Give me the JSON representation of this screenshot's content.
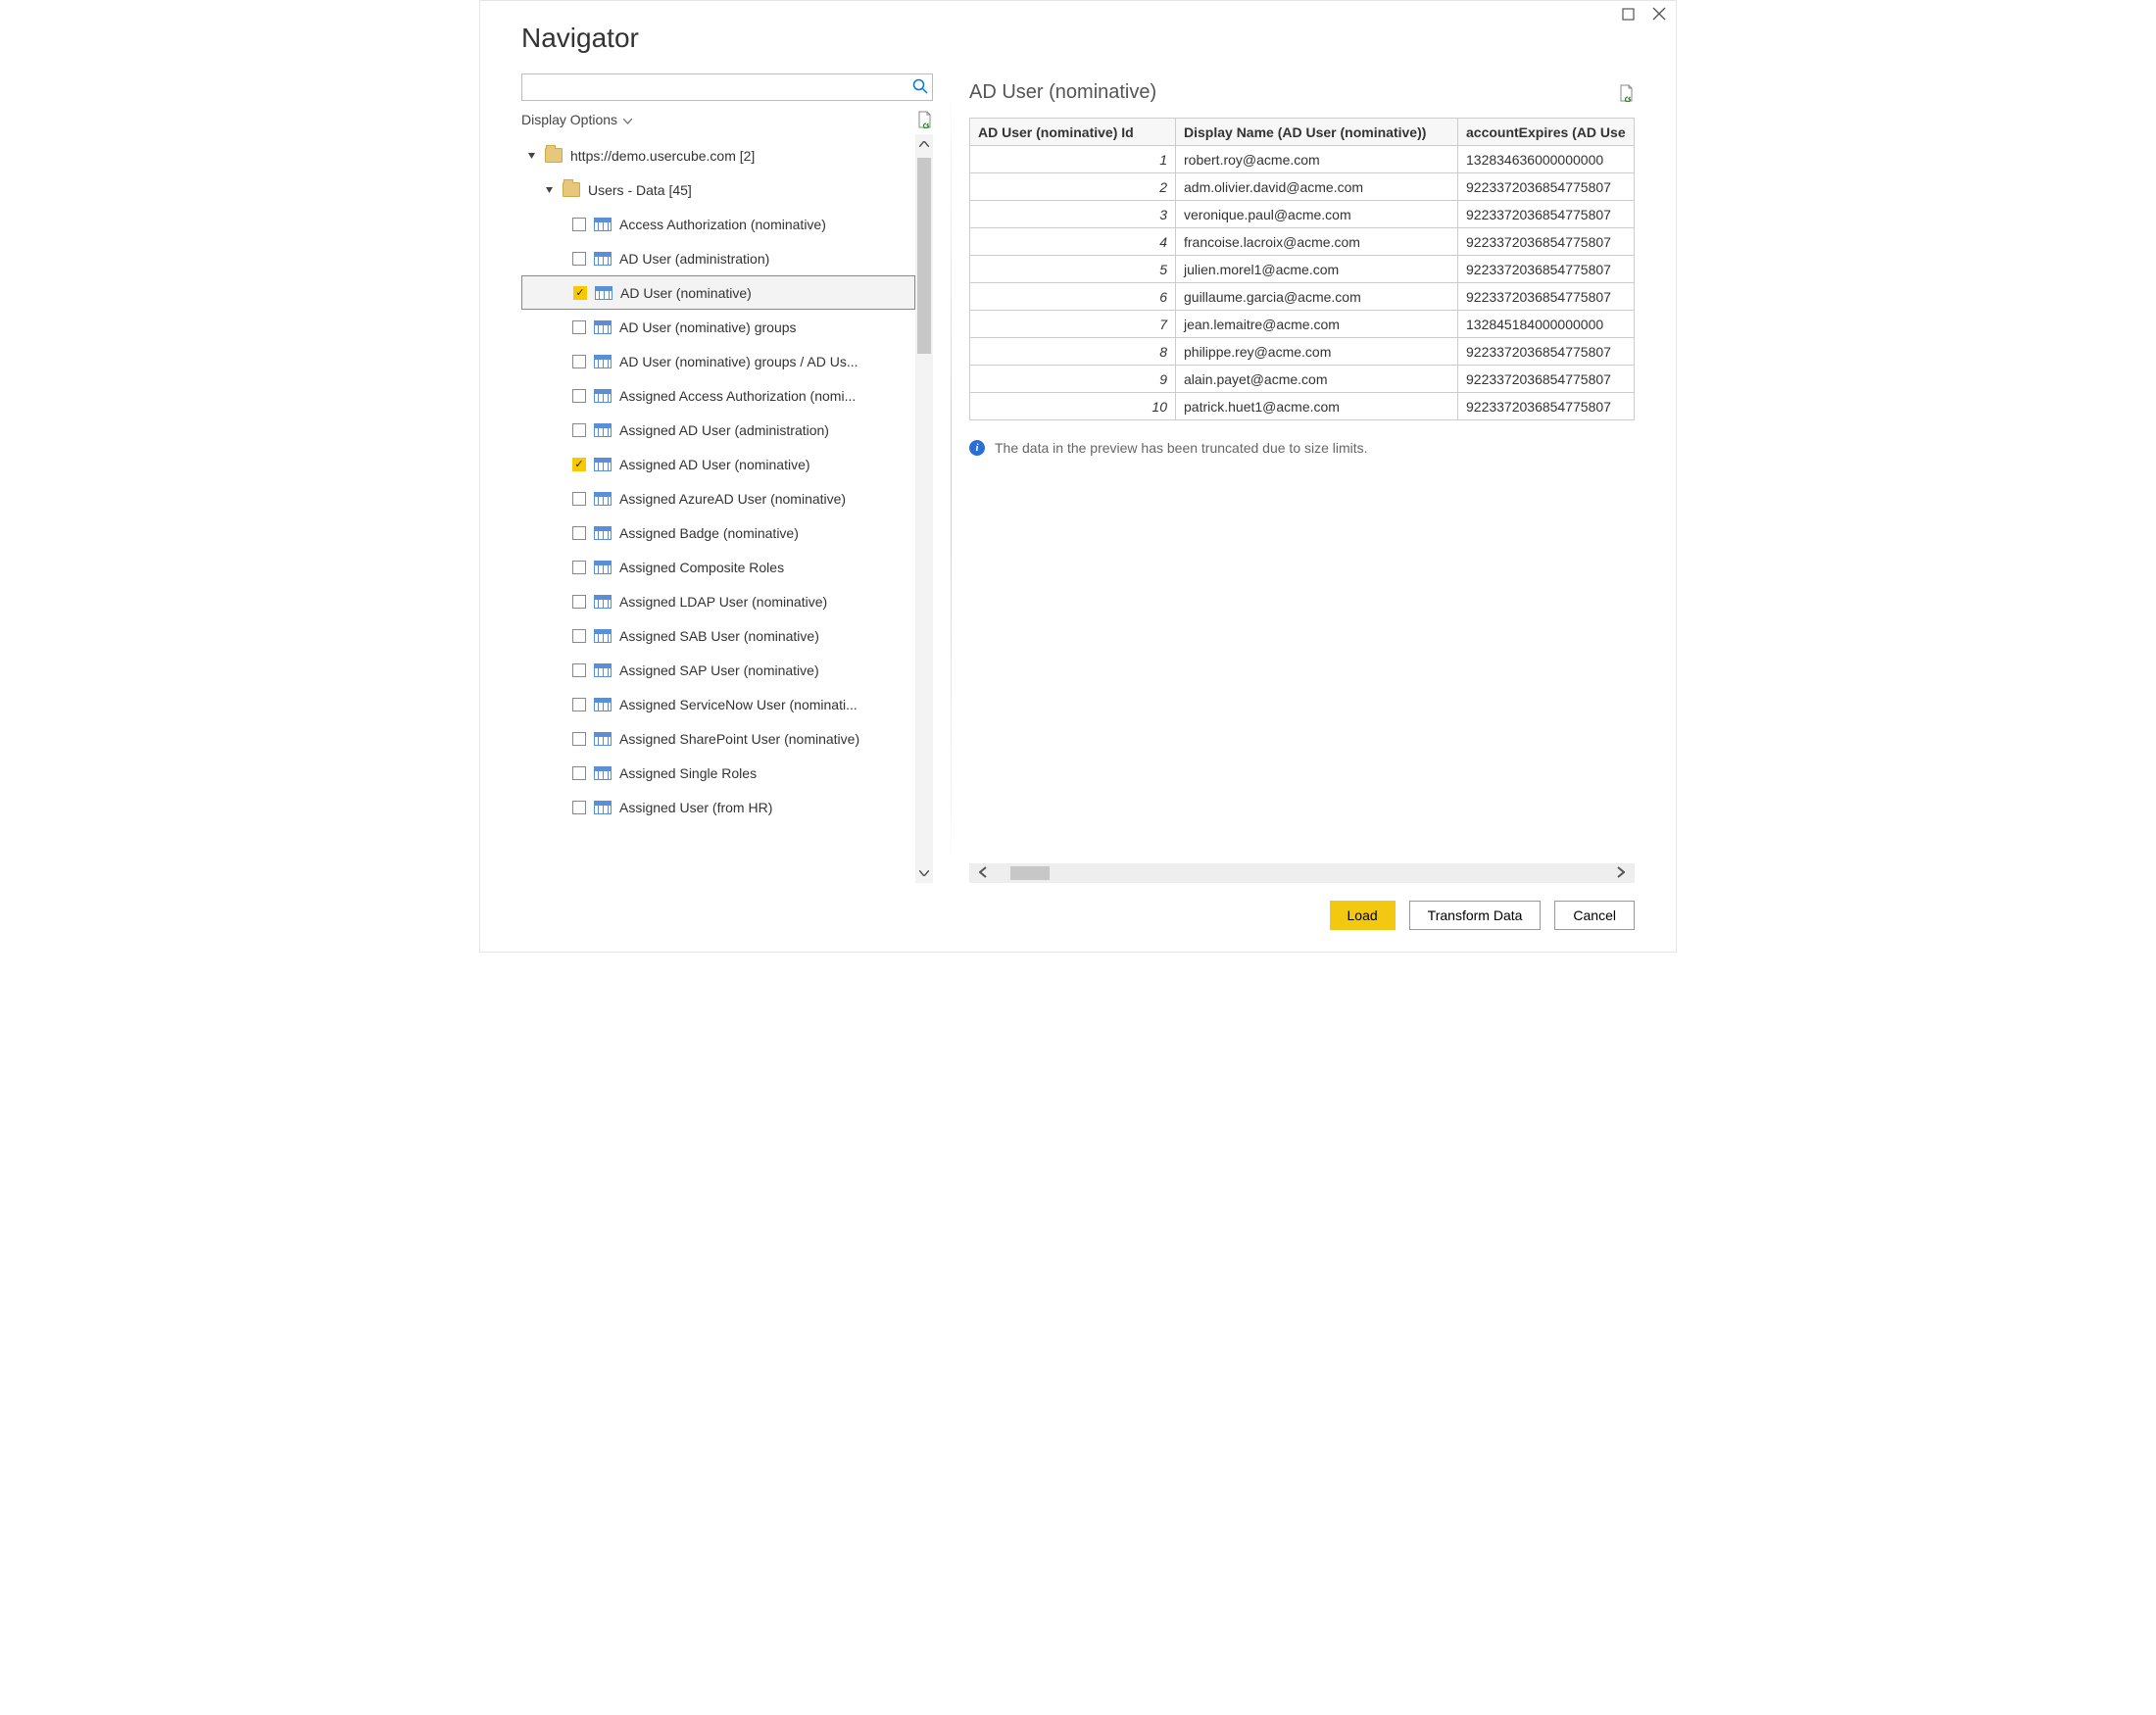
{
  "window": {
    "title": "Navigator"
  },
  "toolbar": {
    "display_options_label": "Display Options"
  },
  "tree": {
    "root": {
      "label": "https://demo.usercube.com [2]"
    },
    "group": {
      "label": "Users - Data [45]"
    },
    "items": [
      {
        "label": "Access Authorization (nominative)",
        "checked": false,
        "selected": false
      },
      {
        "label": "AD User (administration)",
        "checked": false,
        "selected": false
      },
      {
        "label": "AD User (nominative)",
        "checked": true,
        "selected": true
      },
      {
        "label": "AD User (nominative) groups",
        "checked": false,
        "selected": false
      },
      {
        "label": "AD User (nominative) groups / AD Us...",
        "checked": false,
        "selected": false
      },
      {
        "label": "Assigned Access Authorization (nomi...",
        "checked": false,
        "selected": false
      },
      {
        "label": "Assigned AD User (administration)",
        "checked": false,
        "selected": false
      },
      {
        "label": "Assigned AD User (nominative)",
        "checked": true,
        "selected": false
      },
      {
        "label": "Assigned AzureAD User (nominative)",
        "checked": false,
        "selected": false
      },
      {
        "label": "Assigned Badge (nominative)",
        "checked": false,
        "selected": false
      },
      {
        "label": "Assigned Composite Roles",
        "checked": false,
        "selected": false
      },
      {
        "label": "Assigned LDAP User (nominative)",
        "checked": false,
        "selected": false
      },
      {
        "label": "Assigned SAB User (nominative)",
        "checked": false,
        "selected": false
      },
      {
        "label": "Assigned SAP User (nominative)",
        "checked": false,
        "selected": false
      },
      {
        "label": "Assigned ServiceNow User (nominati...",
        "checked": false,
        "selected": false
      },
      {
        "label": "Assigned SharePoint User (nominative)",
        "checked": false,
        "selected": false
      },
      {
        "label": "Assigned Single Roles",
        "checked": false,
        "selected": false
      },
      {
        "label": "Assigned User (from HR)",
        "checked": false,
        "selected": false
      }
    ]
  },
  "preview": {
    "title": "AD User (nominative)",
    "columns": [
      "AD User (nominative) Id",
      "Display Name (AD User (nominative))",
      "accountExpires (AD Use"
    ],
    "rows": [
      {
        "id": "1",
        "name": "robert.roy@acme.com",
        "expires": "132834636000000000"
      },
      {
        "id": "2",
        "name": "adm.olivier.david@acme.com",
        "expires": "9223372036854775807"
      },
      {
        "id": "3",
        "name": "veronique.paul@acme.com",
        "expires": "9223372036854775807"
      },
      {
        "id": "4",
        "name": "francoise.lacroix@acme.com",
        "expires": "9223372036854775807"
      },
      {
        "id": "5",
        "name": "julien.morel1@acme.com",
        "expires": "9223372036854775807"
      },
      {
        "id": "6",
        "name": "guillaume.garcia@acme.com",
        "expires": "9223372036854775807"
      },
      {
        "id": "7",
        "name": "jean.lemaitre@acme.com",
        "expires": "132845184000000000"
      },
      {
        "id": "8",
        "name": "philippe.rey@acme.com",
        "expires": "9223372036854775807"
      },
      {
        "id": "9",
        "name": "alain.payet@acme.com",
        "expires": "9223372036854775807"
      },
      {
        "id": "10",
        "name": "patrick.huet1@acme.com",
        "expires": "9223372036854775807"
      }
    ],
    "truncated_msg": "The data in the preview has been truncated due to size limits."
  },
  "footer": {
    "load": "Load",
    "transform": "Transform Data",
    "cancel": "Cancel"
  }
}
